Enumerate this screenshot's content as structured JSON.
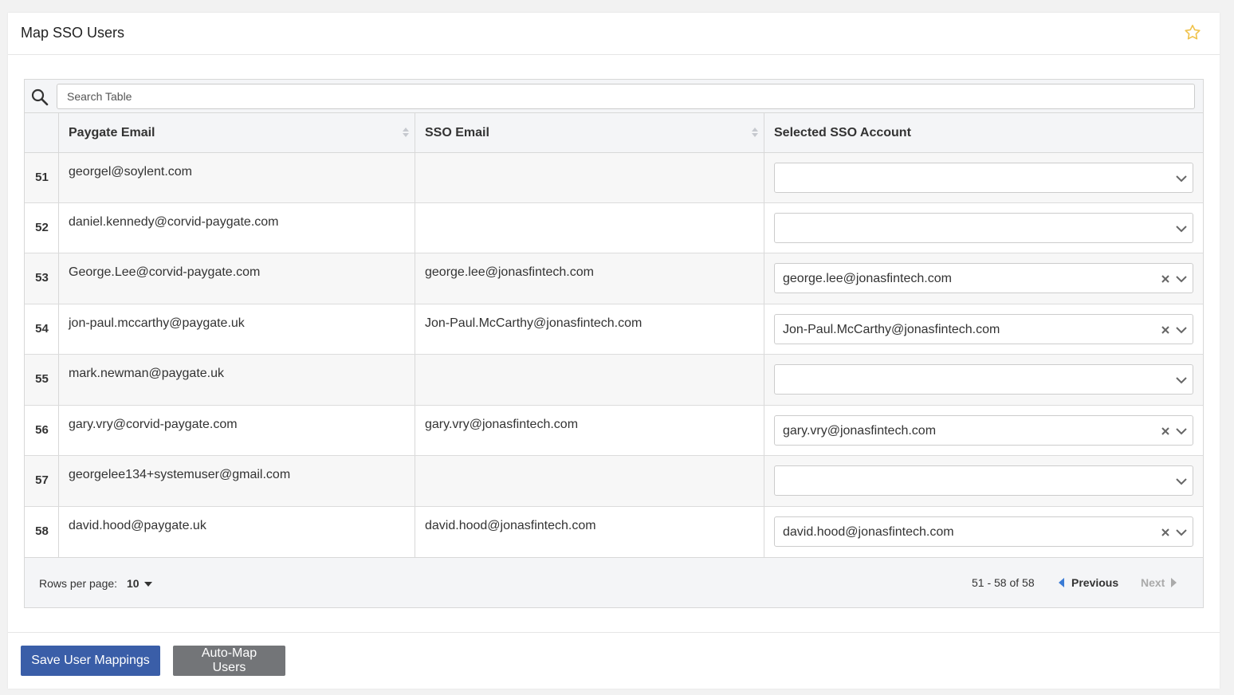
{
  "header": {
    "title": "Map SSO Users",
    "favorite_icon": "star-outline-icon",
    "favorite_color": "#f0c24a"
  },
  "search": {
    "placeholder": "Search Table",
    "value": ""
  },
  "columns": {
    "index": "",
    "paygate_email": "Paygate Email",
    "sso_email": "SSO Email",
    "selected_sso": "Selected SSO Account"
  },
  "rows": [
    {
      "index": "51",
      "paygate_email": "georgel@soylent.com",
      "sso_email": "",
      "selected": ""
    },
    {
      "index": "52",
      "paygate_email": "daniel.kennedy@corvid-paygate.com",
      "sso_email": "",
      "selected": ""
    },
    {
      "index": "53",
      "paygate_email": "George.Lee@corvid-paygate.com",
      "sso_email": "george.lee@jonasfintech.com",
      "selected": "george.lee@jonasfintech.com"
    },
    {
      "index": "54",
      "paygate_email": "jon-paul.mccarthy@paygate.uk",
      "sso_email": "Jon-Paul.McCarthy@jonasfintech.com",
      "selected": "Jon-Paul.McCarthy@jonasfintech.com"
    },
    {
      "index": "55",
      "paygate_email": "mark.newman@paygate.uk",
      "sso_email": "",
      "selected": ""
    },
    {
      "index": "56",
      "paygate_email": "gary.vry@corvid-paygate.com",
      "sso_email": "gary.vry@jonasfintech.com",
      "selected": "gary.vry@jonasfintech.com"
    },
    {
      "index": "57",
      "paygate_email": "georgelee134+systemuser@gmail.com",
      "sso_email": "",
      "selected": ""
    },
    {
      "index": "58",
      "paygate_email": "david.hood@paygate.uk",
      "sso_email": "david.hood@jonasfintech.com",
      "selected": "david.hood@jonasfintech.com"
    }
  ],
  "pagination": {
    "rows_per_page_label": "Rows per page:",
    "rows_per_page_value": "10",
    "range_text": "51 - 58 of 58",
    "previous_label": "Previous",
    "next_label": "Next",
    "accent_color": "#3a7bd5"
  },
  "footer": {
    "save_label": "Save User Mappings",
    "automap_label": "Auto-Map Users",
    "save_color": "#3a5ea8",
    "automap_color": "#737578"
  }
}
